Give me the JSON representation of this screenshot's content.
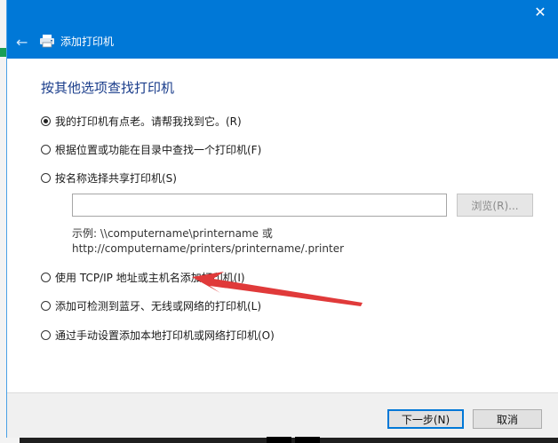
{
  "window": {
    "title": "添加打印机",
    "close_icon": "close-icon",
    "back_icon": "back-arrow-icon",
    "printer_icon": "printer-icon"
  },
  "content": {
    "heading": "按其他选项查找打印机",
    "options": [
      {
        "label": "我的打印机有点老。请帮我找到它。(R)",
        "checked": true
      },
      {
        "label": "根据位置或功能在目录中查找一个打印机(F)",
        "checked": false
      },
      {
        "label": "按名称选择共享打印机(S)",
        "checked": false
      },
      {
        "label": "使用 TCP/IP 地址或主机名添加打印机(I)",
        "checked": false
      },
      {
        "label": "添加可检测到蓝牙、无线或网络的打印机(L)",
        "checked": false
      },
      {
        "label": "通过手动设置添加本地打印机或网络打印机(O)",
        "checked": false
      }
    ],
    "shared_input": {
      "value": "",
      "placeholder": ""
    },
    "browse_label": "浏览(R)...",
    "example_line1": "示例: \\\\computername\\printername 或",
    "example_line2": "http://computername/printers/printername/.printer"
  },
  "footer": {
    "next_label": "下一步(N)",
    "cancel_label": "取消"
  },
  "colors": {
    "titlebar": "#0078d7",
    "heading": "#1a3d8b",
    "annotation_arrow": "#e03a3a"
  }
}
